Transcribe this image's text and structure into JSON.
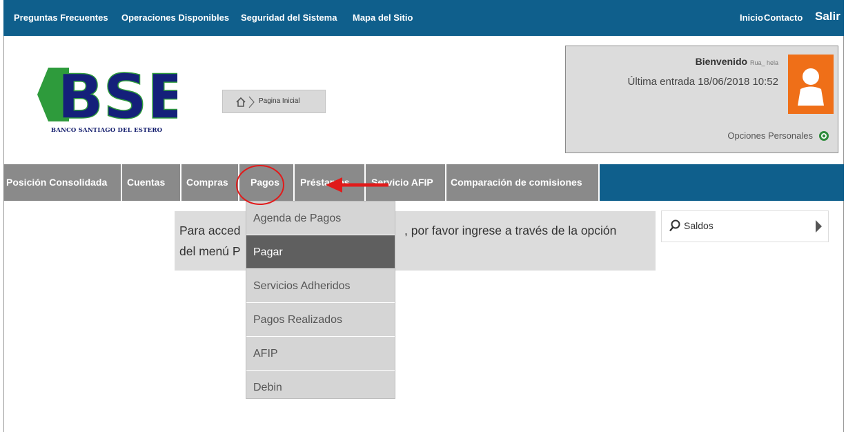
{
  "top_nav": {
    "left_links": [
      "Preguntas Frecuentes",
      "Operaciones Disponibles",
      "Seguridad del Sistema",
      "Mapa del Sitio"
    ],
    "right_links": [
      "Inicio",
      "Contacto",
      "Salir"
    ]
  },
  "logo": {
    "text": "BSE",
    "subtitle": "BANCO SANTIAGO DEL ESTERO",
    "colors": {
      "green": "#2e9b3c",
      "navy": "#14207a"
    }
  },
  "breadcrumb": {
    "icon": "home-icon",
    "label": "Pagina Inicial"
  },
  "user_box": {
    "welcome_label": "Bienvenido",
    "username": "Rua_ hela",
    "last_entry": "Última entrada 18/06/2018 10:52",
    "personal_options": "Opciones Personales",
    "avatar_color": "#ef6f18"
  },
  "main_nav": [
    "Posición Consolidada",
    "Cuentas",
    "Compras",
    "Pagos",
    "Préstamos",
    "Servicio AFIP",
    "Comparación de comisiones"
  ],
  "notice": {
    "line1_left": "Para acced",
    "line1_right": ", por favor ingrese a través de la opción",
    "line2": "del menú P"
  },
  "saldos": {
    "label": "Saldos"
  },
  "pagos_menu": {
    "items": [
      "Agenda de Pagos",
      "Pagar",
      "Servicios Adheridos",
      "Pagos Realizados",
      "AFIP",
      "Debin"
    ],
    "active_index": 1
  },
  "annotation": {
    "color": "#e11b1b"
  },
  "theme": {
    "blue": "#0f5f8c",
    "gray_tab": "#8a8a8a"
  }
}
